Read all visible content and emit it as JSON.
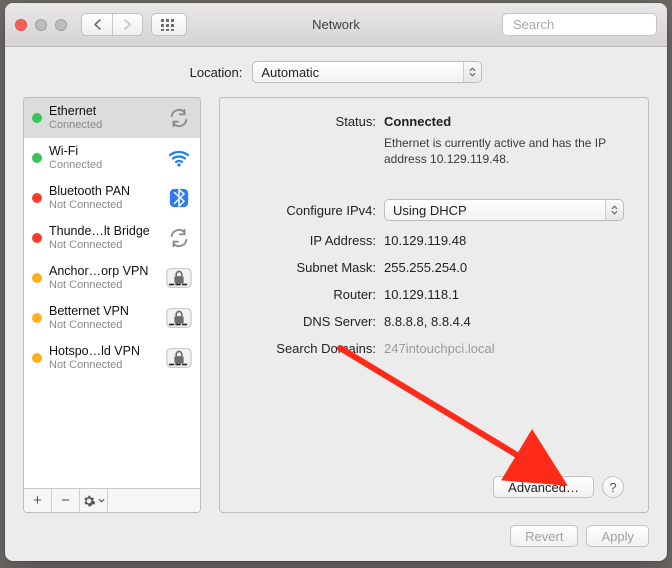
{
  "window": {
    "title": "Network",
    "search_placeholder": "Search"
  },
  "location": {
    "label": "Location:",
    "value": "Automatic"
  },
  "sidebar": {
    "items": [
      {
        "name": "Ethernet",
        "state": "Connected",
        "dot": "green",
        "icon": "sync",
        "selected": true
      },
      {
        "name": "Wi-Fi",
        "state": "Connected",
        "dot": "green",
        "icon": "wifi",
        "selected": false
      },
      {
        "name": "Bluetooth PAN",
        "state": "Not Connected",
        "dot": "red",
        "icon": "bt",
        "selected": false
      },
      {
        "name": "Thunde…lt Bridge",
        "state": "Not Connected",
        "dot": "red",
        "icon": "sync",
        "selected": false
      },
      {
        "name": "Anchor…orp VPN",
        "state": "Not Connected",
        "dot": "orange",
        "icon": "lock",
        "selected": false
      },
      {
        "name": "Betternet VPN",
        "state": "Not Connected",
        "dot": "orange",
        "icon": "lock",
        "selected": false
      },
      {
        "name": "Hotspo…ld VPN",
        "state": "Not Connected",
        "dot": "orange",
        "icon": "lock",
        "selected": false
      }
    ],
    "foot": {
      "plus": "+",
      "minus": "−",
      "gear": "⚙︎▾"
    }
  },
  "panel": {
    "status_label": "Status:",
    "status_value": "Connected",
    "status_sub": "Ethernet is currently active and has the IP address 10.129.119.48.",
    "configure_label": "Configure IPv4:",
    "configure_value": "Using DHCP",
    "ip_label": "IP Address:",
    "ip_value": "10.129.119.48",
    "subnet_label": "Subnet Mask:",
    "subnet_value": "255.255.254.0",
    "router_label": "Router:",
    "router_value": "10.129.118.1",
    "dns_label": "DNS Server:",
    "dns_value": "8.8.8.8, 8.8.4.4",
    "search_label": "Search Domains:",
    "search_value": "247intouchpci.local",
    "advanced": "Advanced…",
    "help": "?"
  },
  "footer": {
    "revert": "Revert",
    "apply": "Apply"
  },
  "annotation": {
    "arrow_color": "#ff2a17"
  }
}
